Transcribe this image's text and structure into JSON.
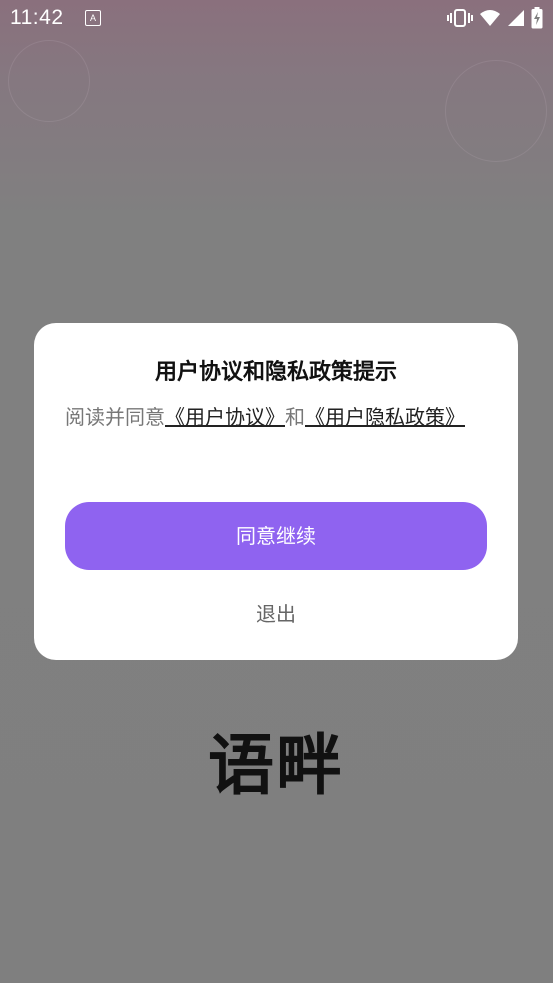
{
  "status_bar": {
    "time": "11:42",
    "notification_glyph": "A",
    "icons": [
      "vibrate-icon",
      "wifi-icon",
      "signal-icon",
      "battery-charging-icon"
    ]
  },
  "dialog": {
    "title": "用户协议和隐私政策提示",
    "body_prefix": "阅读并同意",
    "link_user_agreement": "《用户协议》",
    "body_conjunction": "和",
    "link_privacy_policy": "《用户隐私政策》",
    "agree_label": "同意继续",
    "exit_label": "退出"
  },
  "app_logo": "语畔",
  "colors": {
    "accent": "#8f63f0",
    "overlay": "#7f7f7f",
    "dialog_bg": "#ffffff"
  }
}
